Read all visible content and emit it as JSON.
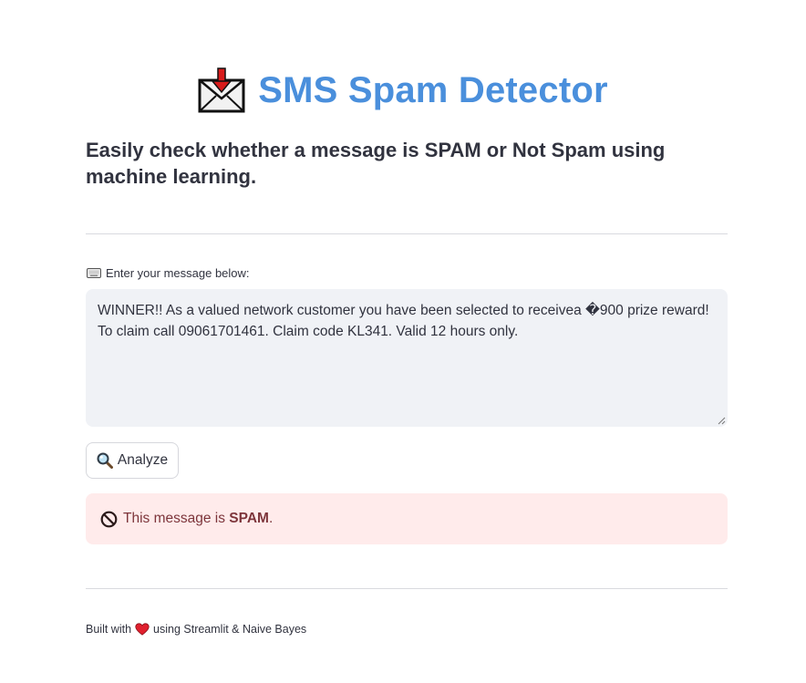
{
  "header": {
    "title": "SMS Spam Detector",
    "title_icon": "incoming-envelope-icon",
    "subtitle": "Easily check whether a message is SPAM or Not Spam using machine learning."
  },
  "input": {
    "label_icon": "keyboard-icon",
    "label": "Enter your message below:",
    "value": "WINNER!! As a valued network customer you have been selected to receivea �900 prize reward! To claim call 09061701461. Claim code KL341. Valid 12 hours only."
  },
  "analyze_button": {
    "icon": "magnifying-glass-icon",
    "label": "Analyze"
  },
  "result": {
    "icon": "prohibited-icon",
    "prefix": "This message is ",
    "verdict": "SPAM",
    "suffix": "."
  },
  "footer": {
    "prefix": "Built with",
    "icon": "heart-icon",
    "suffix": "using Streamlit & Naive Bayes"
  },
  "colors": {
    "title": "#4a8fdc",
    "text": "#31333f",
    "input_bg": "#f0f2f6",
    "alert_bg": "#ffebeb",
    "alert_text": "#7d353b",
    "heart": "#e0202e"
  }
}
